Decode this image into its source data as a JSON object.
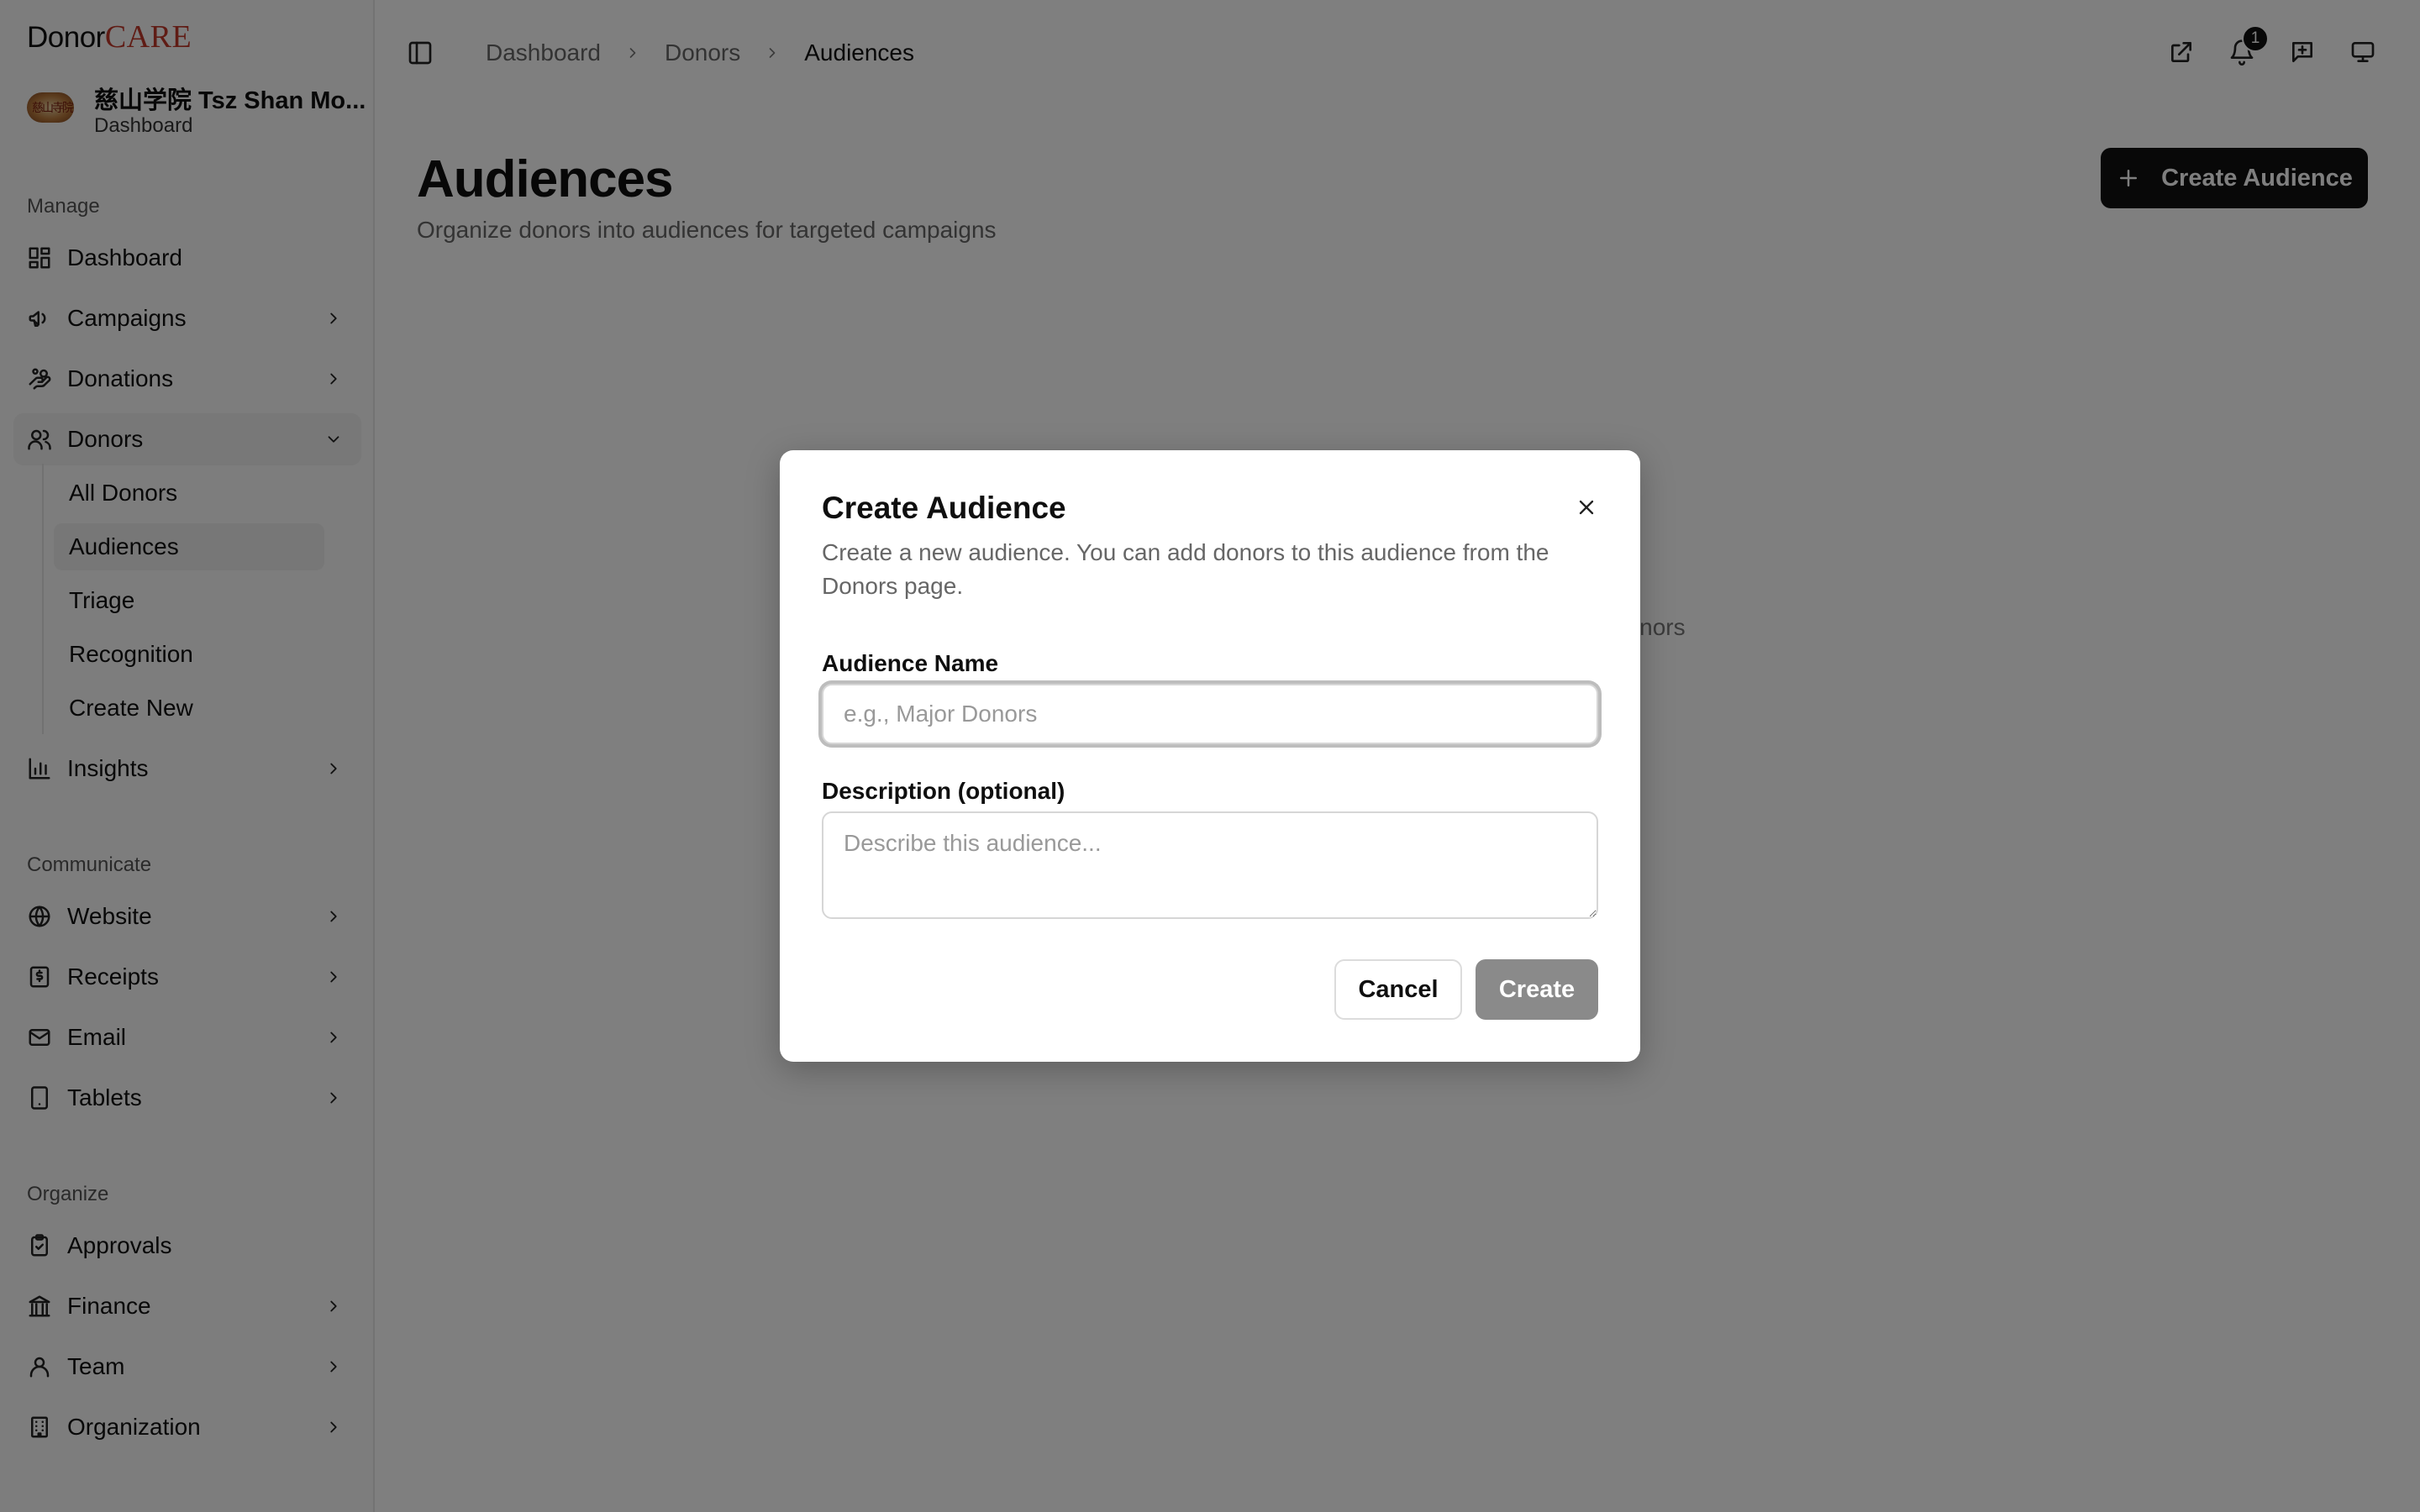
{
  "brand": {
    "donor": "Donor",
    "care": "CARE"
  },
  "org": {
    "name": "慈山学院 Tsz Shan Mo...",
    "subtitle": "Dashboard",
    "logo_text": "慈山寺院"
  },
  "sidebar": {
    "sections": {
      "manage": "Manage",
      "communicate": "Communicate",
      "organize": "Organize"
    },
    "items": {
      "dashboard": "Dashboard",
      "campaigns": "Campaigns",
      "donations": "Donations",
      "donors": "Donors",
      "insights": "Insights",
      "website": "Website",
      "receipts": "Receipts",
      "email": "Email",
      "tablets": "Tablets",
      "approvals": "Approvals",
      "finance": "Finance",
      "team": "Team",
      "organization": "Organization"
    },
    "donors_sub": {
      "all_donors": "All Donors",
      "audiences": "Audiences",
      "triage": "Triage",
      "recognition": "Recognition",
      "create_new": "Create New"
    }
  },
  "breadcrumb": [
    "Dashboard",
    "Donors",
    "Audiences"
  ],
  "notifications": {
    "count": "1"
  },
  "page": {
    "title": "Audiences",
    "subtitle": "Organize donors into audiences for targeted campaigns",
    "create_button": "Create Audience",
    "empty_text_fragment": "donors"
  },
  "modal": {
    "title": "Create Audience",
    "description": "Create a new audience. You can add donors to this audience from the Donors page.",
    "name_label": "Audience Name",
    "name_placeholder": "e.g., Major Donors",
    "name_value": "",
    "description_label": "Description (optional)",
    "description_placeholder": "Describe this audience...",
    "description_value": "",
    "cancel": "Cancel",
    "create": "Create"
  }
}
